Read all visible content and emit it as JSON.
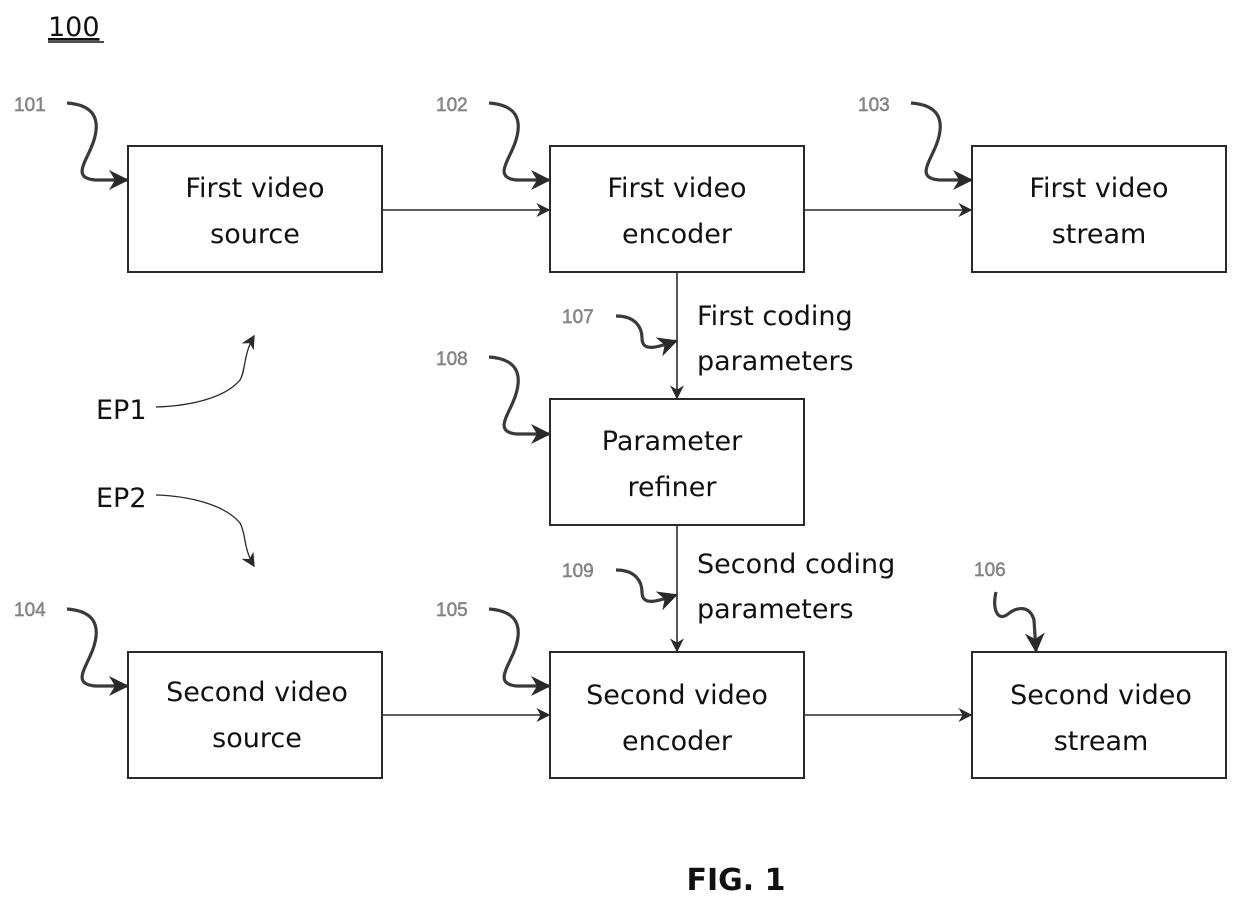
{
  "figure": {
    "number_label": "100",
    "caption": "FIG. 1"
  },
  "blocks": {
    "first_video_source": {
      "ref": "101",
      "lines": [
        "First video",
        "source"
      ]
    },
    "first_video_encoder": {
      "ref": "102",
      "lines": [
        "First video",
        "encoder"
      ]
    },
    "first_video_stream": {
      "ref": "103",
      "lines": [
        "First video",
        "stream"
      ]
    },
    "parameter_refiner": {
      "ref": "108",
      "lines": [
        "Parameter",
        "refiner"
      ]
    },
    "second_video_source": {
      "ref": "104",
      "lines": [
        "Second video",
        "source"
      ]
    },
    "second_video_encoder": {
      "ref": "105",
      "lines": [
        "Second video",
        "encoder"
      ]
    },
    "second_video_stream": {
      "ref": "106",
      "lines": [
        "Second video",
        "stream"
      ]
    }
  },
  "flows": {
    "first_coding_parameters": {
      "ref": "107",
      "lines": [
        "First coding",
        "parameters"
      ]
    },
    "second_coding_parameters": {
      "ref": "109",
      "lines": [
        "Second coding",
        "parameters"
      ]
    }
  },
  "endpoints": {
    "ep1": "EP1",
    "ep2": "EP2"
  }
}
